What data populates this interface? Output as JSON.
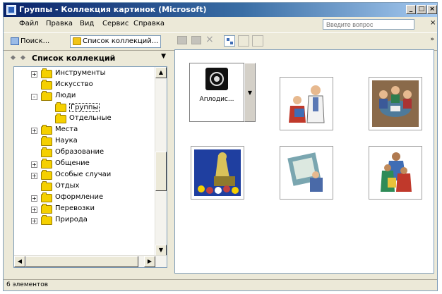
{
  "window": {
    "title": "Группы - Коллекция картинок (Microsoft)",
    "min_label": "_",
    "max_label": "□",
    "close_label": "×"
  },
  "menubar": {
    "items": [
      "Файл",
      "Правка",
      "Вид",
      "Сервис",
      "Справка"
    ],
    "ask_placeholder": "Введите вопрос",
    "close_label": "×"
  },
  "toolbar": {
    "search_label": "Поиск...",
    "collections_label": "Список коллекций...",
    "chevron": "»"
  },
  "left_pane": {
    "header": "Список коллекций",
    "dropdown": "▼",
    "tree": [
      {
        "label": "Инструменты",
        "level": 1,
        "expander": "+"
      },
      {
        "label": "Искусство",
        "level": 1,
        "expander": ""
      },
      {
        "label": "Люди",
        "level": 1,
        "expander": "-"
      },
      {
        "label": "Группы",
        "level": 2,
        "expander": "",
        "selected": true
      },
      {
        "label": "Отдельные",
        "level": 2,
        "expander": ""
      },
      {
        "label": "Места",
        "level": 1,
        "expander": "+"
      },
      {
        "label": "Наука",
        "level": 1,
        "expander": ""
      },
      {
        "label": "Образование",
        "level": 1,
        "expander": ""
      },
      {
        "label": "Общение",
        "level": 1,
        "expander": "+"
      },
      {
        "label": "Особые случаи",
        "level": 1,
        "expander": "+"
      },
      {
        "label": "Отдых",
        "level": 1,
        "expander": ""
      },
      {
        "label": "Оформление",
        "level": 1,
        "expander": "+"
      },
      {
        "label": "Перевозки",
        "level": 1,
        "expander": "+"
      },
      {
        "label": "Природа",
        "level": 1,
        "expander": "+"
      }
    ]
  },
  "right_pane": {
    "items": [
      {
        "name": "applause",
        "caption": "Аплодис...",
        "icon": "applause-icon"
      },
      {
        "name": "teacher-student",
        "caption": "",
        "icon": "teacher-student-icon"
      },
      {
        "name": "meeting",
        "caption": "",
        "icon": "meeting-icon"
      },
      {
        "name": "stage-performer",
        "caption": "",
        "icon": "stage-performer-icon"
      },
      {
        "name": "painter",
        "caption": "",
        "icon": "painter-icon"
      },
      {
        "name": "crowd",
        "caption": "",
        "icon": "crowd-icon"
      }
    ],
    "arrow": "▼"
  },
  "status": {
    "text": "6 элементов"
  }
}
